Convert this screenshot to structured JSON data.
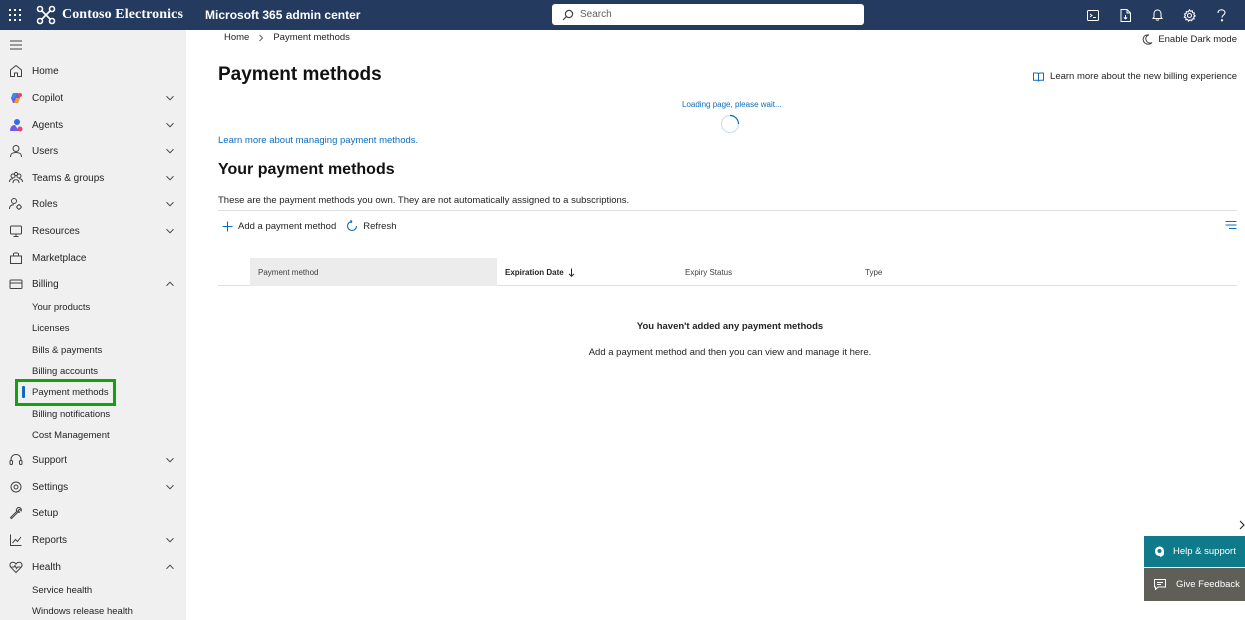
{
  "topbar": {
    "org_name": "Contoso Electronics",
    "app_name": "Microsoft 365 admin center",
    "search_placeholder": "Search",
    "bg_color": "#243a5e",
    "icons": [
      "terminal-icon",
      "document-download-icon",
      "notification-bell-icon",
      "settings-gear-icon",
      "help-question-icon"
    ]
  },
  "sidebar": {
    "items": [
      {
        "label": "Home",
        "icon": "home-icon"
      },
      {
        "label": "Copilot",
        "icon": "copilot-icon"
      },
      {
        "label": "Agents",
        "icon": "agents-icon"
      },
      {
        "label": "Users",
        "icon": "user-icon"
      },
      {
        "label": "Teams & groups",
        "icon": "teams-groups-icon"
      },
      {
        "label": "Roles",
        "icon": "roles-icon"
      },
      {
        "label": "Resources",
        "icon": "resources-icon"
      },
      {
        "label": "Marketplace",
        "icon": "marketplace-icon"
      },
      {
        "label": "Billing",
        "icon": "billing-icon"
      },
      {
        "label": "Support",
        "icon": "support-icon"
      },
      {
        "label": "Settings",
        "icon": "settings-icon"
      },
      {
        "label": "Setup",
        "icon": "setup-icon"
      },
      {
        "label": "Reports",
        "icon": "reports-icon"
      },
      {
        "label": "Health",
        "icon": "health-icon"
      }
    ],
    "billing_sub": [
      "Your products",
      "Licenses",
      "Bills & payments",
      "Billing accounts",
      "Payment methods",
      "Billing notifications",
      "Cost Management"
    ],
    "health_sub": [
      "Service health",
      "Windows release health"
    ],
    "active_item": "Payment methods",
    "highlight_color": "#13a10e"
  },
  "breadcrumb": {
    "home": "Home",
    "current": "Payment methods"
  },
  "header": {
    "dark_mode": "Enable Dark mode",
    "title": "Payment methods",
    "learn_billing": "Learn more about the new billing experience"
  },
  "loading": {
    "text": "Loading page, please wait..."
  },
  "content": {
    "learn_link": "Learn more about managing payment methods.",
    "section_title": "Your payment methods",
    "section_desc": "These are the payment methods you own. They are not automatically assigned to a subscriptions.",
    "add_button": "Add a payment method",
    "refresh_button": "Refresh",
    "columns": [
      "Payment method",
      "Expiration Date",
      "Expiry Status",
      "Type"
    ],
    "empty_title": "You haven't added any payment methods",
    "empty_desc": "Add a payment method and then you can view and manage it here."
  },
  "floating": {
    "help": "Help & support",
    "feedback": "Give Feedback"
  }
}
